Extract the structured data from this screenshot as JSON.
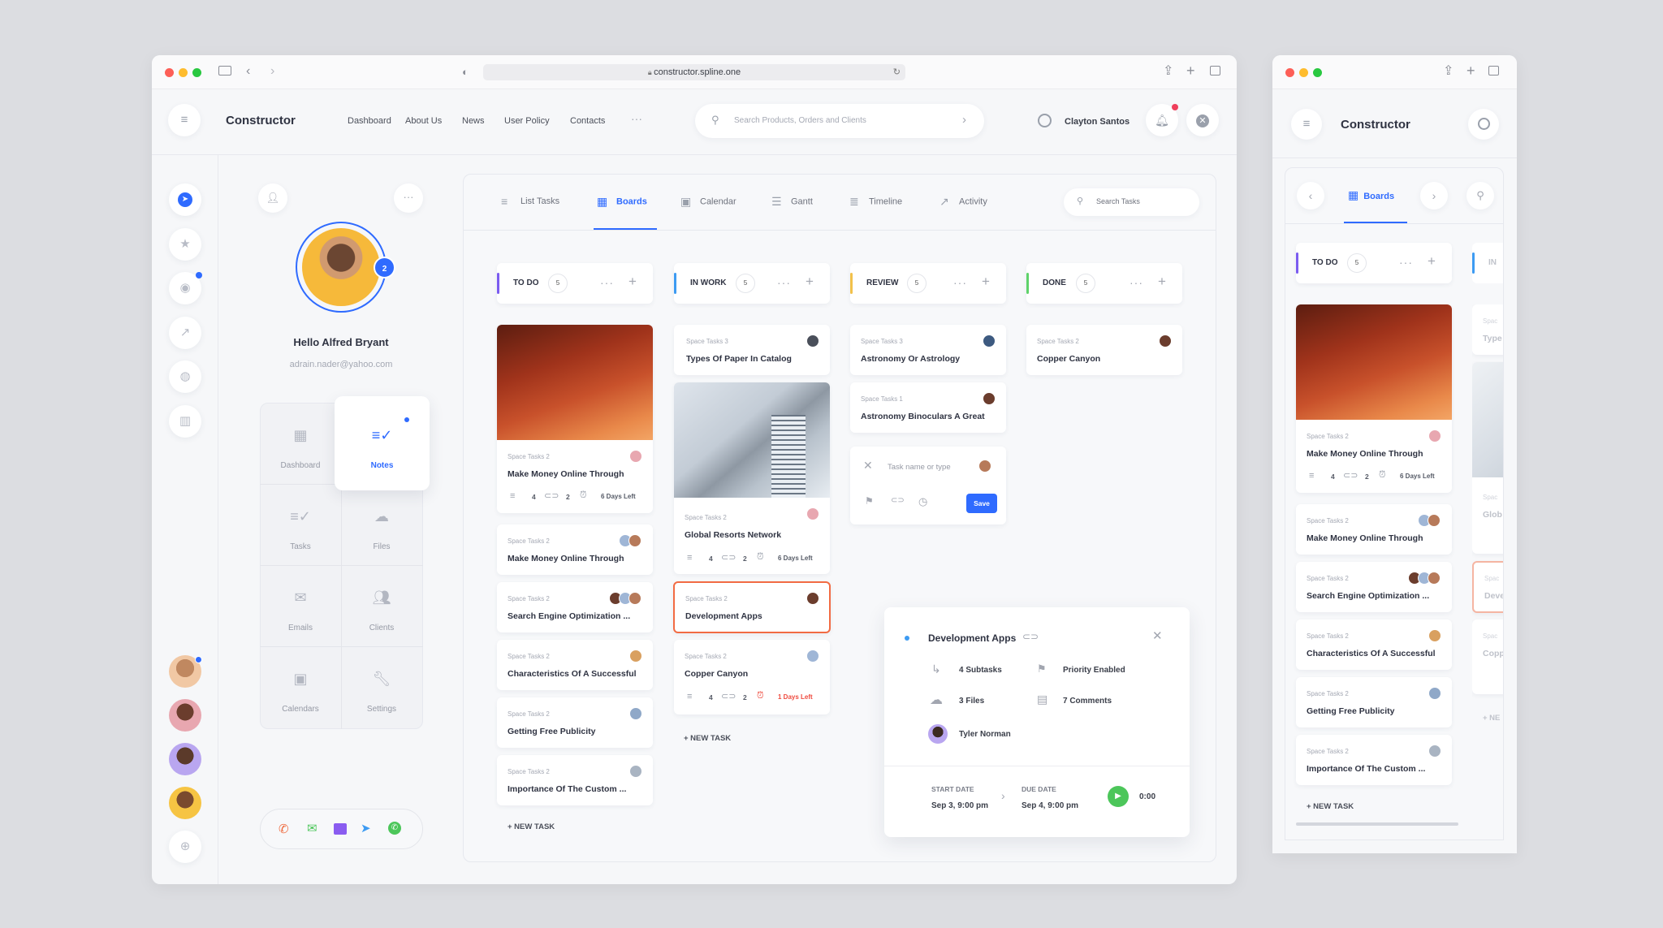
{
  "browser": {
    "url": "constructor.spline.one"
  },
  "app": {
    "title": "Constructor"
  },
  "nav": {
    "links": [
      "Dashboard",
      "About Us",
      "News",
      "User Policy",
      "Contacts"
    ],
    "more": "···"
  },
  "search": {
    "placeholder": "Search Products, Orders and Clients"
  },
  "user": {
    "name": "Clayton Santos"
  },
  "profile": {
    "greeting": "Hello Alfred Bryant",
    "email": "adrain.nader@yahoo.com",
    "badge": "2"
  },
  "menu_tiles": [
    {
      "label": "Dashboard",
      "icon": "dashboard-icon"
    },
    {
      "label": "Notes",
      "icon": "notes-icon"
    },
    {
      "label": "Tasks",
      "icon": "tasks-icon"
    },
    {
      "label": "Files",
      "icon": "cloud-icon"
    },
    {
      "label": "Emails",
      "icon": "mail-icon"
    },
    {
      "label": "Clients",
      "icon": "clients-icon"
    },
    {
      "label": "Calendars",
      "icon": "calendar-icon"
    },
    {
      "label": "Settings",
      "icon": "wrench-icon"
    }
  ],
  "tabs": [
    {
      "label": "List Tasks",
      "icon": "list-icon"
    },
    {
      "label": "Boards",
      "icon": "boards-icon",
      "active": true
    },
    {
      "label": "Calendar",
      "icon": "calendar-icon"
    },
    {
      "label": "Gantt",
      "icon": "gantt-icon"
    },
    {
      "label": "Timeline",
      "icon": "timeline-icon"
    },
    {
      "label": "Activity",
      "icon": "activity-icon"
    }
  ],
  "task_search": {
    "placeholder": "Search Tasks"
  },
  "columns": [
    {
      "name": "TO DO",
      "count": "5",
      "color": "#7b5cf0"
    },
    {
      "name": "IN WORK",
      "count": "5",
      "color": "#3d9bf2"
    },
    {
      "name": "REVIEW",
      "count": "5",
      "color": "#f2c14b"
    },
    {
      "name": "DONE",
      "count": "5",
      "color": "#5fd36a"
    }
  ],
  "todo": [
    {
      "sub": "Space Tasks 2",
      "title": "Make Money Online Through",
      "subtasks": "4",
      "attachments": "2",
      "due": "6 Days Left"
    },
    {
      "sub": "Space Tasks 2",
      "title": "Make Money Online Through"
    },
    {
      "sub": "Space Tasks 2",
      "title": "Search Engine Optimization ..."
    },
    {
      "sub": "Space Tasks 2",
      "title": "Characteristics Of A Successful"
    },
    {
      "sub": "Space Tasks 2",
      "title": "Getting Free Publicity"
    },
    {
      "sub": "Space Tasks 2",
      "title": "Importance Of The Custom ..."
    }
  ],
  "inwork": [
    {
      "sub": "Space Tasks 3",
      "title": "Types Of Paper In Catalog"
    },
    {
      "sub": "Space Tasks 2",
      "title": "Global Resorts Network",
      "subtasks": "4",
      "attachments": "2",
      "due": "6 Days Left"
    },
    {
      "sub": "Space Tasks 2",
      "title": "Development Apps"
    },
    {
      "sub": "Space Tasks 2",
      "title": "Copper Canyon",
      "subtasks": "4",
      "attachments": "2",
      "due": "1 Days Left"
    }
  ],
  "review": [
    {
      "sub": "Space Tasks 3",
      "title": "Astronomy Or Astrology"
    },
    {
      "sub": "Space Tasks 1",
      "title": "Astronomy Binoculars A Great"
    }
  ],
  "done": [
    {
      "sub": "Space Tasks 2",
      "title": "Copper Canyon"
    }
  ],
  "new_task": {
    "placeholder": "Task name or type",
    "save": "Save"
  },
  "new_task_label": "+ NEW TASK",
  "detail": {
    "title": "Development Apps",
    "subtasks": "4 Subtasks",
    "priority": "Priority Enabled",
    "files": "3 Files",
    "comments": "7 Comments",
    "assignee": "Tyler Norman",
    "start_label": "START DATE",
    "start": "Sep 3, 9:00 pm",
    "due_label": "DUE DATE",
    "due": "Sep 4, 9:00 pm",
    "timer": "0:00"
  },
  "mobile": {
    "title": "Constructor",
    "tab": "Boards",
    "column": {
      "name": "TO DO",
      "count": "5"
    },
    "partial_column": "IN",
    "cards": [
      {
        "sub": "Space Tasks 2",
        "title": "Make Money Online Through",
        "subtasks": "4",
        "attachments": "2",
        "due": "6 Days Left"
      },
      {
        "sub": "Space Tasks 2",
        "title": "Make Money Online Through"
      },
      {
        "sub": "Space Tasks 2",
        "title": "Search Engine Optimization ..."
      },
      {
        "sub": "Space Tasks 2",
        "title": "Characteristics Of A Successful"
      },
      {
        "sub": "Space Tasks 2",
        "title": "Getting Free Publicity"
      },
      {
        "sub": "Space Tasks 2",
        "title": "Importance Of The Custom ..."
      }
    ],
    "partial_cards": [
      "Spac",
      "Type",
      "Spac",
      "Glob",
      "Spac",
      "Deve",
      "Spac",
      "Copp"
    ],
    "new_task": "+ NEW TASK",
    "new_task_partial": "+ NE"
  },
  "colors": {
    "accent": "#2f6bff",
    "danger": "#ef4b3f",
    "success": "#4cc65a",
    "highlight": "#f26b43"
  }
}
